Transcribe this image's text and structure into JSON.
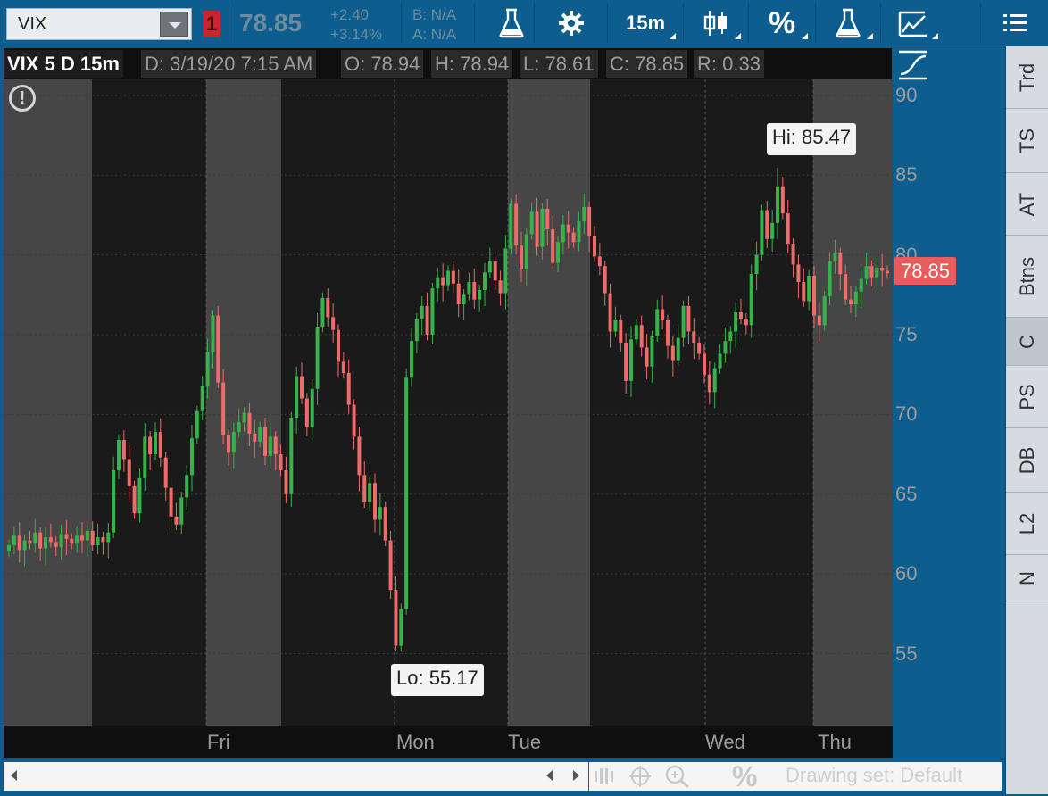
{
  "toolbar": {
    "symbol": "VIX",
    "link_badge": "1",
    "last_price": "78.85",
    "change_abs": "+2.40",
    "change_pct": "+3.14%",
    "bid": "B: N/A",
    "ask": "A: N/A",
    "interval": "15m",
    "percent_label": "%",
    "icons": [
      "flask-icon",
      "gear-icon",
      "candlestick-icon",
      "percent-icon",
      "flask-icon",
      "drawing-icon",
      "menu-icon"
    ]
  },
  "chart_header": {
    "title": "VIX 5 D 15m",
    "date": "D: 3/19/20 7:15 AM",
    "open": "O: 78.94",
    "high": "H: 78.94",
    "low": "L: 78.61",
    "close": "C: 78.85",
    "range": "R: 0.33"
  },
  "price_axis": {
    "ticks": [
      "90",
      "85",
      "80",
      "75",
      "70",
      "65",
      "60",
      "55"
    ],
    "current_price_tag": "78.85"
  },
  "annotations": {
    "low_bubble": "Lo: 55.17",
    "high_bubble": "Hi: 85.47",
    "alert_icon": "!"
  },
  "x_axis": {
    "days": [
      "Fri",
      "Mon",
      "Tue",
      "Wed",
      "Thu"
    ]
  },
  "side_tabs": [
    {
      "label": "Trd",
      "active": false
    },
    {
      "label": "TS",
      "active": false
    },
    {
      "label": "AT",
      "active": false
    },
    {
      "label": "Btns",
      "active": false
    },
    {
      "label": "C",
      "active": true
    },
    {
      "label": "PS",
      "active": false
    },
    {
      "label": "DB",
      "active": false
    },
    {
      "label": "L2",
      "active": false
    },
    {
      "label": "N",
      "active": false
    }
  ],
  "bottom_bar": {
    "drawing_set": "Drawing set: Default",
    "percent_label": "%"
  },
  "colors": {
    "up": "#36b24a",
    "down": "#f06a6a",
    "extended_hours_bg": "#464646",
    "regular_hours_bg": "#1a1a1a",
    "price_tag": "#ea5b5b",
    "toolbar_bg": "#0d5e8e"
  },
  "chart_data": {
    "type": "candlestick",
    "title": "VIX 5 D 15m",
    "ylim": [
      50.5,
      91
    ],
    "y_ticks": [
      55,
      60,
      65,
      70,
      75,
      80,
      85,
      90
    ],
    "days": [
      "Thu",
      "Fri",
      "Mon",
      "Tue",
      "Wed",
      "Thu"
    ],
    "sessions": [
      {
        "day": "Thu",
        "kind": "extended"
      },
      {
        "day": "Thu",
        "kind": "regular"
      },
      {
        "day": "Fri",
        "kind": "extended"
      },
      {
        "day": "Fri",
        "kind": "regular"
      },
      {
        "day": "Mon",
        "kind": "regular"
      },
      {
        "day": "Tue",
        "kind": "extended"
      },
      {
        "day": "Tue",
        "kind": "regular"
      },
      {
        "day": "Wed",
        "kind": "regular"
      },
      {
        "day": "Thu",
        "kind": "extended"
      }
    ],
    "low": 55.17,
    "high": 85.47,
    "last": 78.85,
    "closes": [
      61.8,
      62.4,
      61.5,
      62.1,
      61.9,
      62.6,
      61.6,
      62.3,
      62.0,
      61.7,
      62.5,
      62.2,
      61.9,
      62.4,
      62.1,
      62.7,
      61.8,
      62.3,
      62.0,
      62.6,
      66.5,
      68.4,
      67.2,
      65.5,
      63.8,
      66.0,
      68.6,
      67.5,
      68.9,
      67.3,
      65.4,
      63.6,
      63.1,
      64.8,
      66.2,
      68.5,
      70.2,
      71.8,
      73.9,
      76.2,
      72.0,
      68.7,
      67.6,
      68.9,
      69.5,
      70.1,
      68.8,
      68.3,
      69.2,
      67.4,
      68.6,
      67.5,
      66.5,
      65.0,
      69.8,
      72.4,
      71.0,
      69.2,
      71.6,
      75.5,
      77.3,
      76.1,
      75.3,
      73.3,
      72.6,
      70.6,
      68.6,
      66.2,
      64.5,
      65.7,
      63.4,
      64.2,
      62.1,
      59.0,
      55.5,
      57.8,
      72.3,
      74.6,
      76.0,
      76.8,
      75.0,
      77.9,
      78.6,
      78.1,
      79.0,
      78.2,
      76.9,
      77.5,
      78.3,
      77.2,
      77.8,
      78.9,
      79.6,
      78.4,
      77.6,
      80.4,
      83.2,
      80.6,
      79.1,
      81.3,
      82.7,
      80.5,
      82.9,
      81.6,
      79.5,
      80.8,
      81.9,
      81.4,
      80.8,
      82.1,
      83.0,
      81.2,
      79.9,
      79.3,
      77.6,
      75.2,
      75.9,
      74.5,
      72.1,
      74.7,
      75.6,
      74.2,
      73.0,
      74.9,
      76.6,
      75.9,
      74.3,
      73.4,
      74.8,
      76.8,
      75.2,
      74.5,
      73.8,
      72.5,
      71.4,
      72.9,
      73.8,
      74.6,
      75.2,
      76.4,
      76.0,
      75.6,
      78.8,
      80.0,
      82.8,
      81.0,
      82.0,
      84.3,
      82.6,
      80.7,
      79.4,
      78.3,
      77.1,
      78.7,
      76.2,
      75.6,
      77.4,
      79.6,
      80.1,
      78.8,
      77.2,
      76.9,
      77.7,
      78.5,
      79.3,
      78.6,
      79.2,
      79.0,
      78.85
    ]
  }
}
